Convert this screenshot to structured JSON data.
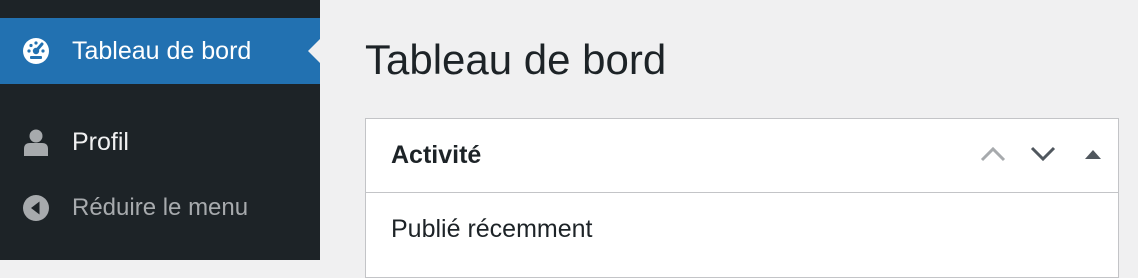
{
  "sidebar": {
    "items": [
      {
        "label": "Tableau de bord",
        "icon": "dashboard-gauge-icon",
        "active": true
      },
      {
        "label": "Profil",
        "icon": "user-icon",
        "active": false
      },
      {
        "label": "Réduire le menu",
        "icon": "collapse-arrow-icon",
        "active": false
      }
    ]
  },
  "page": {
    "title": "Tableau de bord"
  },
  "widget": {
    "title": "Activité",
    "section_title": "Publié récemment",
    "actions": [
      "move-up-icon",
      "move-down-icon",
      "toggle-panel-icon"
    ]
  },
  "colors": {
    "sidebar_bg": "#1d2327",
    "active_bg": "#2271b1",
    "page_bg": "#f0f0f1",
    "muted_text": "#a7aaad"
  }
}
